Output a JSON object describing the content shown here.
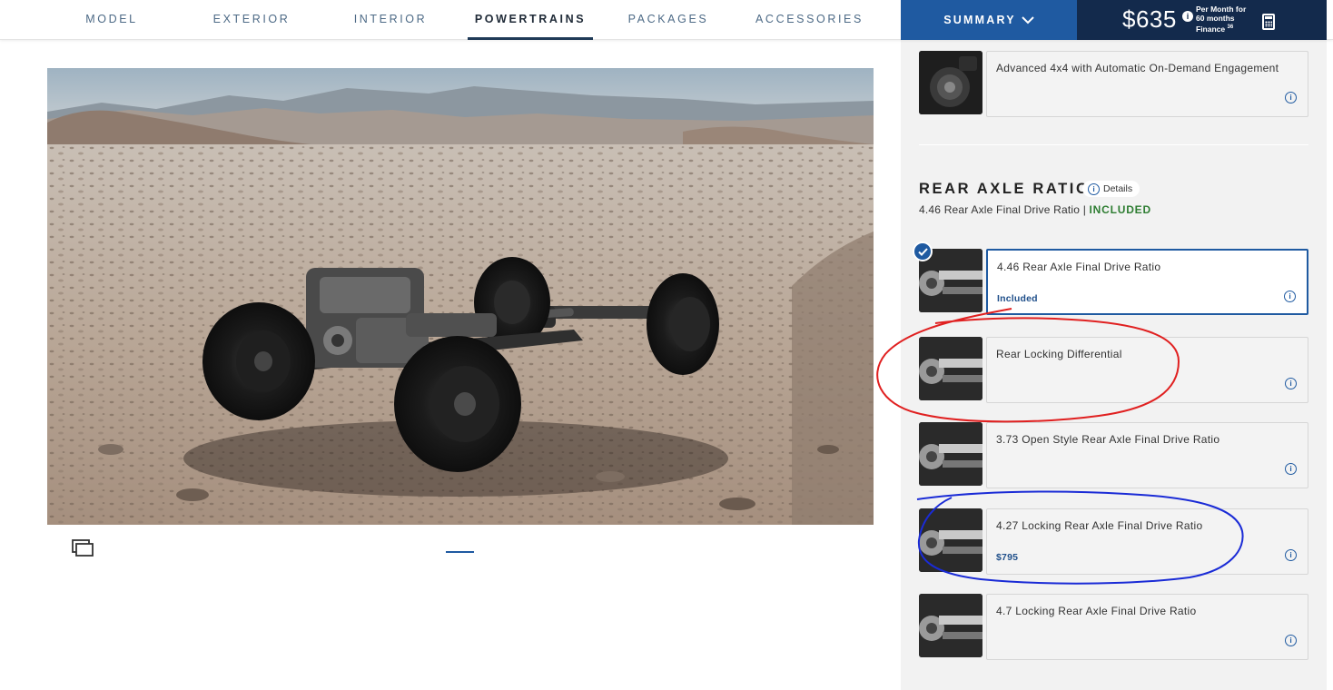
{
  "nav": {
    "tabs": [
      {
        "label": "MODEL"
      },
      {
        "label": "EXTERIOR"
      },
      {
        "label": "INTERIOR"
      },
      {
        "label": "POWERTRAINS"
      },
      {
        "label": "PACKAGES"
      },
      {
        "label": "ACCESSORIES"
      }
    ],
    "active_tab": "POWERTRAINS",
    "summary_label": "SUMMARY",
    "price": {
      "amount": "$635",
      "info_glyph": "i",
      "terms_line1": "Per Month for",
      "terms_line2": "60 months",
      "terms_line3": "Finance",
      "terms_footnote": "36"
    }
  },
  "colors": {
    "accent": "#1f5aa1",
    "navy": "#132a4c",
    "included_green": "#2e7d32",
    "annotation_red": "#e02020",
    "annotation_blue": "#1a2bd6"
  },
  "hero": {
    "image_subject": "off-road chassis with four wheels in desert landscape",
    "fullscreen_icon": "fullscreen-icon"
  },
  "drivetrain_card": {
    "title": "Advanced 4x4 with Automatic On-Demand Engagement"
  },
  "rear_axle": {
    "section_title": "REAR AXLE RATIO",
    "details_label": "Details",
    "current_value": "4.46 Rear Axle Final Drive Ratio",
    "separator": " | ",
    "current_status": "INCLUDED",
    "options": [
      {
        "title": "4.46 Rear Axle Final Drive Ratio",
        "sub": "Included",
        "selected": true
      },
      {
        "title": "Rear Locking Differential",
        "sub": "",
        "selected": false
      },
      {
        "title": "3.73 Open Style Rear Axle Final Drive Ratio",
        "sub": "",
        "selected": false
      },
      {
        "title": "4.27 Locking Rear Axle Final Drive Ratio",
        "sub": "$795",
        "selected": false
      },
      {
        "title": "4.7 Locking Rear Axle Final Drive Ratio",
        "sub": "",
        "selected": false
      }
    ]
  }
}
